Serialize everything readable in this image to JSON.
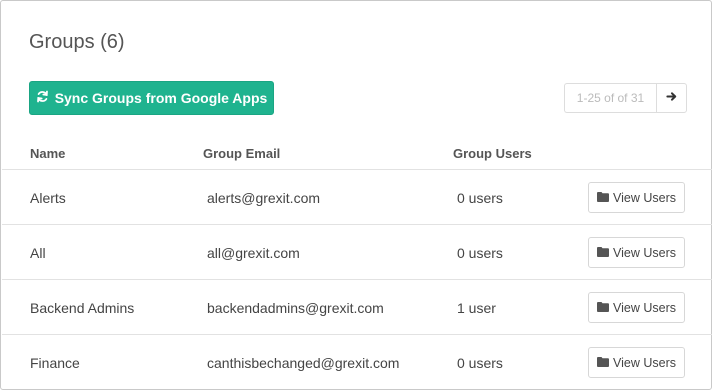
{
  "header": {
    "title": "Groups (6)",
    "sync_button_label": "Sync Groups from Google Apps",
    "sync_icon": "refresh-icon"
  },
  "pagination": {
    "info": "1-25 of of 31",
    "next_icon": "arrow-right-icon"
  },
  "table": {
    "columns": [
      "Name",
      "Group Email",
      "Group Users"
    ],
    "view_button_label": "View Users",
    "view_button_icon": "folder-icon",
    "rows": [
      {
        "name": "Alerts",
        "email": "alerts@grexit.com",
        "users": "0 users"
      },
      {
        "name": "All",
        "email": "all@grexit.com",
        "users": "0 users"
      },
      {
        "name": "Backend Admins",
        "email": "backendadmins@grexit.com",
        "users": "1 user"
      },
      {
        "name": "Finance",
        "email": "canthisbechanged@grexit.com",
        "users": "0 users"
      }
    ]
  },
  "colors": {
    "accent": "#1fb38f",
    "border": "#c9c9c9"
  }
}
